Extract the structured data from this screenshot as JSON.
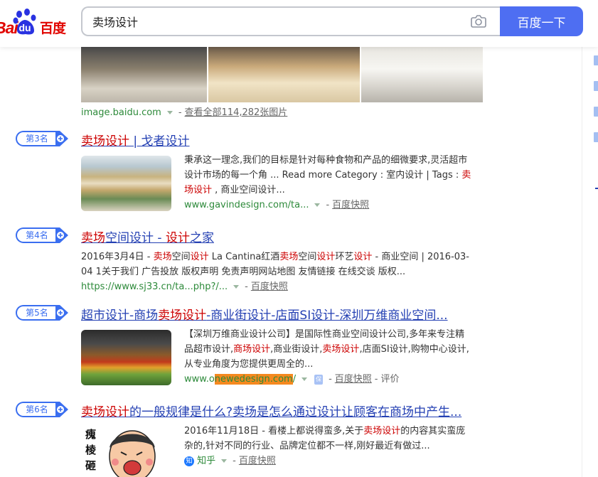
{
  "header": {
    "logo_latin_bai": "Bai",
    "logo_latin_du": "du",
    "logo_chinese": "百度",
    "search_value": "卖场设计",
    "search_button": "百度一下"
  },
  "image_result": {
    "source": "image.baidu.com",
    "view_all": "查看全部114,282张图片"
  },
  "results": [
    {
      "rank": "第3名",
      "title_parts": [
        "卖场设计",
        " | 戈者设计"
      ],
      "snippet_l1": "秉承这一理念,我们的目标是针对每种食物和产品的细微要求,灵活超市",
      "snippet_l2": "设计市场的每一个角 ... Read more Category : 室内设计 | Tags : ",
      "snippet_l2_hl": "卖",
      "snippet_l3_hl": "场设计",
      "snippet_l3": " , 商业空间设计...",
      "url": "www.gavindesign.com/ta...",
      "snapshot": "百度快照"
    },
    {
      "rank": "第4名",
      "title_parts": [
        "卖场",
        "空间设计 - ",
        "设计",
        "之家"
      ],
      "snippet_l1_a": "2016年3月4日 - ",
      "snippet_l1_b": "卖场",
      "snippet_l1_c": "空间",
      "snippet_l1_d": "设计",
      "snippet_l1_e": " La Cantina红酒",
      "snippet_l1_f": "卖场",
      "snippet_l1_g": "空间",
      "snippet_l1_h": "设计",
      "snippet_l1_i": "环艺",
      "snippet_l1_j": "设计",
      "snippet_l1_k": " - 商业空间 | 2016-03-",
      "snippet_l2": "04 1关于我们 广告投放 版权声明 免责声明网站地图 友情链接 在线交谈 版权...",
      "url": "https://www.sj33.cn/ta...php?/...",
      "snapshot": "百度快照"
    },
    {
      "rank": "第5名",
      "title_parts": [
        "超市设计-商场",
        "卖场设计",
        "-商业街设计-店面SI设计-深圳万维商业空间..."
      ],
      "snippet_l1": "【深圳万维商业设计公司】是国际性商业空间设计公司,多年来专注精",
      "snippet_l2_a": "品超市设计,",
      "snippet_l2_b": "商场设计",
      "snippet_l2_c": ",商业街设计,",
      "snippet_l2_d": "卖场设计",
      "snippet_l2_e": ",店面SI设计,购物中心设计,",
      "snippet_l3": "从专业角度为您提供更周全的...",
      "url_a": "www.o",
      "url_b": "newedesign.com",
      "url_c": "/",
      "snapshot": "百度快照",
      "review": "评价"
    },
    {
      "rank": "第6名",
      "title_parts": [
        "卖场设计",
        "的一般规律是什么?卖场是怎么通过设计让顾客在商场中产生..."
      ],
      "snippet_l1_a": "2016年11月18日 - 看楼上都说得蛮多,关于",
      "snippet_l1_b": "卖场设计",
      "snippet_l1_c": "的内容其实蛮庞",
      "snippet_l2": "杂的,针对不同的行业、品牌定位都不一样,刚好最近有做过...",
      "source": "知乎",
      "snapshot": "百度快照"
    }
  ],
  "colors": {
    "brand_blue": "#4e6ef2",
    "link_blue": "#2440b3",
    "highlight_red": "#c00",
    "url_green": "#2d8a3a"
  }
}
